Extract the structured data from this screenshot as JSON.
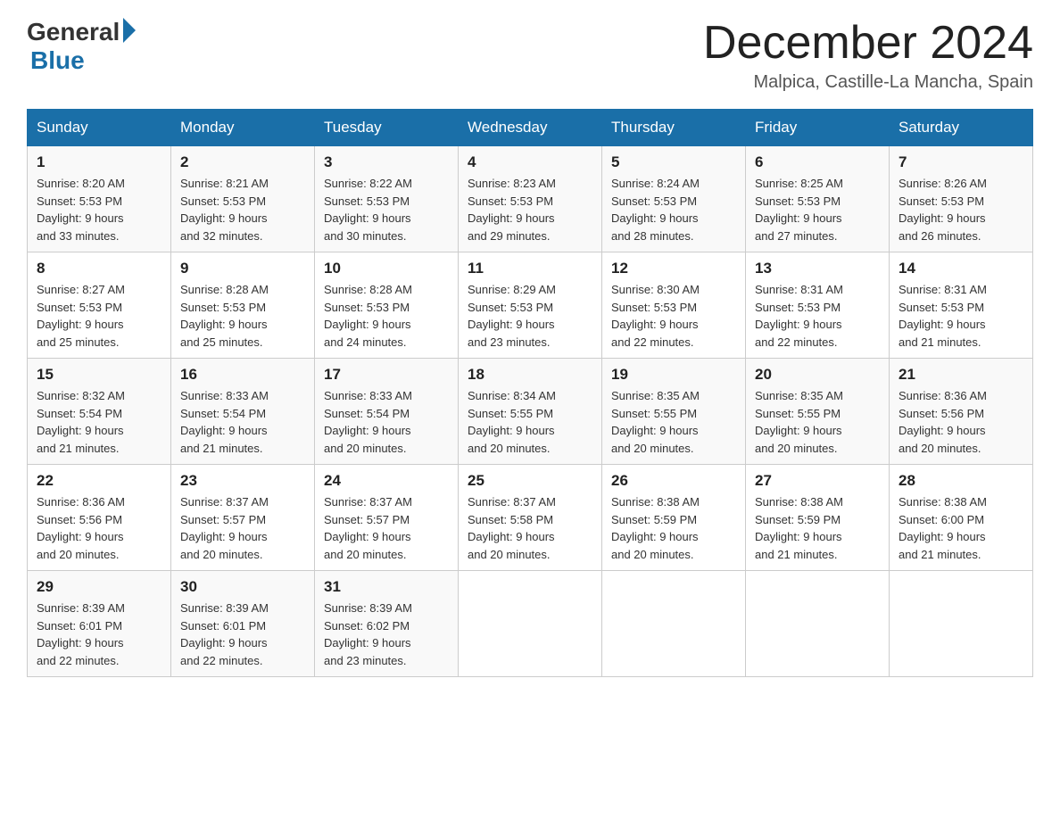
{
  "logo": {
    "general": "General",
    "blue": "Blue"
  },
  "header": {
    "title": "December 2024",
    "subtitle": "Malpica, Castille-La Mancha, Spain"
  },
  "days_of_week": [
    "Sunday",
    "Monday",
    "Tuesday",
    "Wednesday",
    "Thursday",
    "Friday",
    "Saturday"
  ],
  "weeks": [
    [
      {
        "day": "1",
        "sunrise": "8:20 AM",
        "sunset": "5:53 PM",
        "daylight": "9 hours and 33 minutes."
      },
      {
        "day": "2",
        "sunrise": "8:21 AM",
        "sunset": "5:53 PM",
        "daylight": "9 hours and 32 minutes."
      },
      {
        "day": "3",
        "sunrise": "8:22 AM",
        "sunset": "5:53 PM",
        "daylight": "9 hours and 30 minutes."
      },
      {
        "day": "4",
        "sunrise": "8:23 AM",
        "sunset": "5:53 PM",
        "daylight": "9 hours and 29 minutes."
      },
      {
        "day": "5",
        "sunrise": "8:24 AM",
        "sunset": "5:53 PM",
        "daylight": "9 hours and 28 minutes."
      },
      {
        "day": "6",
        "sunrise": "8:25 AM",
        "sunset": "5:53 PM",
        "daylight": "9 hours and 27 minutes."
      },
      {
        "day": "7",
        "sunrise": "8:26 AM",
        "sunset": "5:53 PM",
        "daylight": "9 hours and 26 minutes."
      }
    ],
    [
      {
        "day": "8",
        "sunrise": "8:27 AM",
        "sunset": "5:53 PM",
        "daylight": "9 hours and 25 minutes."
      },
      {
        "day": "9",
        "sunrise": "8:28 AM",
        "sunset": "5:53 PM",
        "daylight": "9 hours and 25 minutes."
      },
      {
        "day": "10",
        "sunrise": "8:28 AM",
        "sunset": "5:53 PM",
        "daylight": "9 hours and 24 minutes."
      },
      {
        "day": "11",
        "sunrise": "8:29 AM",
        "sunset": "5:53 PM",
        "daylight": "9 hours and 23 minutes."
      },
      {
        "day": "12",
        "sunrise": "8:30 AM",
        "sunset": "5:53 PM",
        "daylight": "9 hours and 22 minutes."
      },
      {
        "day": "13",
        "sunrise": "8:31 AM",
        "sunset": "5:53 PM",
        "daylight": "9 hours and 22 minutes."
      },
      {
        "day": "14",
        "sunrise": "8:31 AM",
        "sunset": "5:53 PM",
        "daylight": "9 hours and 21 minutes."
      }
    ],
    [
      {
        "day": "15",
        "sunrise": "8:32 AM",
        "sunset": "5:54 PM",
        "daylight": "9 hours and 21 minutes."
      },
      {
        "day": "16",
        "sunrise": "8:33 AM",
        "sunset": "5:54 PM",
        "daylight": "9 hours and 21 minutes."
      },
      {
        "day": "17",
        "sunrise": "8:33 AM",
        "sunset": "5:54 PM",
        "daylight": "9 hours and 20 minutes."
      },
      {
        "day": "18",
        "sunrise": "8:34 AM",
        "sunset": "5:55 PM",
        "daylight": "9 hours and 20 minutes."
      },
      {
        "day": "19",
        "sunrise": "8:35 AM",
        "sunset": "5:55 PM",
        "daylight": "9 hours and 20 minutes."
      },
      {
        "day": "20",
        "sunrise": "8:35 AM",
        "sunset": "5:55 PM",
        "daylight": "9 hours and 20 minutes."
      },
      {
        "day": "21",
        "sunrise": "8:36 AM",
        "sunset": "5:56 PM",
        "daylight": "9 hours and 20 minutes."
      }
    ],
    [
      {
        "day": "22",
        "sunrise": "8:36 AM",
        "sunset": "5:56 PM",
        "daylight": "9 hours and 20 minutes."
      },
      {
        "day": "23",
        "sunrise": "8:37 AM",
        "sunset": "5:57 PM",
        "daylight": "9 hours and 20 minutes."
      },
      {
        "day": "24",
        "sunrise": "8:37 AM",
        "sunset": "5:57 PM",
        "daylight": "9 hours and 20 minutes."
      },
      {
        "day": "25",
        "sunrise": "8:37 AM",
        "sunset": "5:58 PM",
        "daylight": "9 hours and 20 minutes."
      },
      {
        "day": "26",
        "sunrise": "8:38 AM",
        "sunset": "5:59 PM",
        "daylight": "9 hours and 20 minutes."
      },
      {
        "day": "27",
        "sunrise": "8:38 AM",
        "sunset": "5:59 PM",
        "daylight": "9 hours and 21 minutes."
      },
      {
        "day": "28",
        "sunrise": "8:38 AM",
        "sunset": "6:00 PM",
        "daylight": "9 hours and 21 minutes."
      }
    ],
    [
      {
        "day": "29",
        "sunrise": "8:39 AM",
        "sunset": "6:01 PM",
        "daylight": "9 hours and 22 minutes."
      },
      {
        "day": "30",
        "sunrise": "8:39 AM",
        "sunset": "6:01 PM",
        "daylight": "9 hours and 22 minutes."
      },
      {
        "day": "31",
        "sunrise": "8:39 AM",
        "sunset": "6:02 PM",
        "daylight": "9 hours and 23 minutes."
      },
      null,
      null,
      null,
      null
    ]
  ],
  "labels": {
    "sunrise": "Sunrise:",
    "sunset": "Sunset:",
    "daylight": "Daylight:"
  }
}
